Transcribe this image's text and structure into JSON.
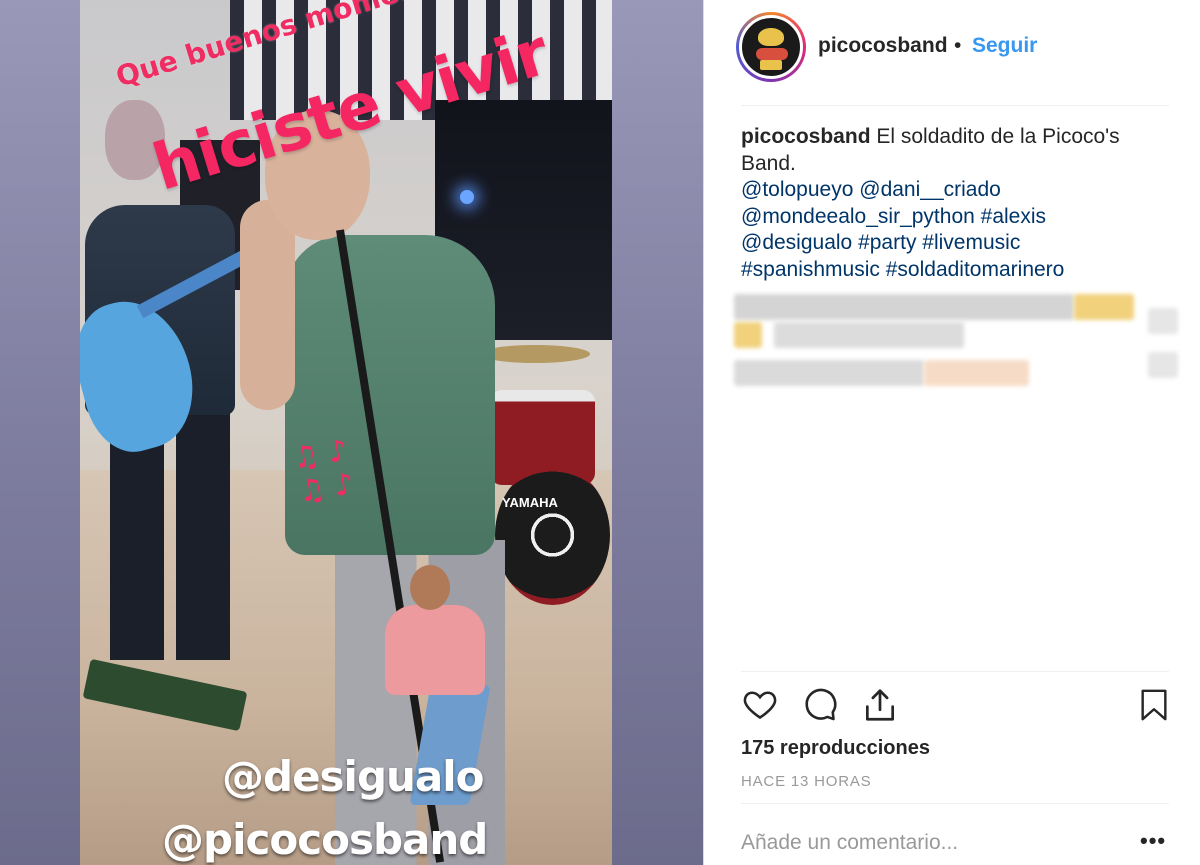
{
  "post": {
    "username": "picocosband",
    "separator": "•",
    "follow_label": "Seguir",
    "caption": {
      "username": "picocosband",
      "text": " El soldadito de la Picoco's Band.",
      "mentions_line_1": [
        "@tolopueyo",
        "@dani__criado"
      ],
      "mentions_line_2": [
        "@mondeealo_sir_python",
        "#alexis"
      ],
      "mentions_line_3": [
        "@desigualo",
        "#party",
        "#livemusic"
      ],
      "mentions_line_4": [
        "#spanishmusic",
        "#soldaditomarinero"
      ]
    },
    "views": "175 reproducciones",
    "timestamp": "HACE 13 HORAS",
    "comment_placeholder": "Añade un comentario...",
    "more_label": "•••"
  },
  "media": {
    "overlay_line_1": "Que buenos momentos nos",
    "overlay_line_2": "hiciste vivir",
    "music_notes": "♫ ♪\n♫ ♪",
    "mention_1": "@desigualo",
    "mention_2": "@picocosband",
    "drum_brand": "YAMAHA"
  },
  "icons": {
    "like": "heart-icon",
    "comment": "comment-icon",
    "share": "share-icon",
    "save": "bookmark-icon"
  },
  "colors": {
    "link": "#003569",
    "follow": "#3897f0",
    "overlay_pink": "#f42763"
  }
}
